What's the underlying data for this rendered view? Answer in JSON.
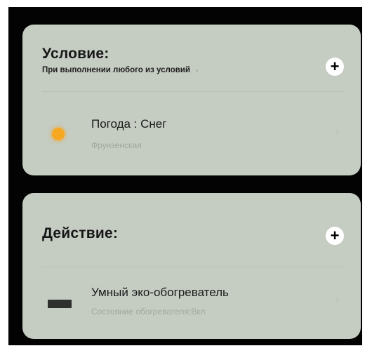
{
  "condition": {
    "title": "Условие:",
    "subtitle": "При выполнении любого из условий",
    "subtitle_chevron": "›",
    "add_label": "+",
    "items": [
      {
        "title": "Погода : Снег",
        "subtitle": "Фрунзенская",
        "icon": "sun-icon",
        "chevron": "›"
      }
    ]
  },
  "action": {
    "title": "Действие:",
    "add_label": "+",
    "items": [
      {
        "title": "Умный эко-обогреватель",
        "subtitle": "Состояние обогревателя:Вкл",
        "icon": "heater-icon",
        "chevron": "›"
      }
    ]
  },
  "colors": {
    "background": "#030303",
    "card": "#c5ccc2",
    "sun": "#f7a823",
    "heater": "#2e302d"
  }
}
